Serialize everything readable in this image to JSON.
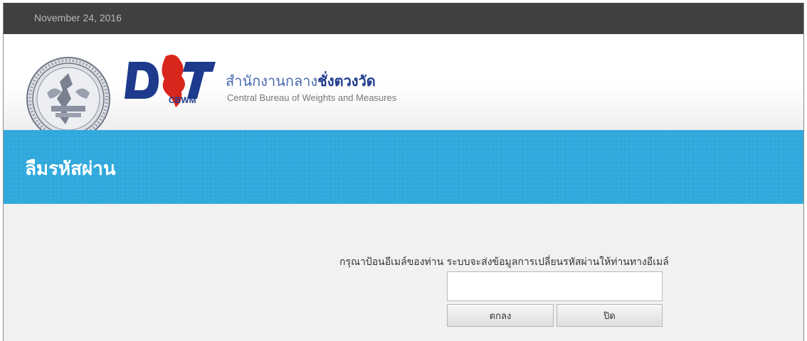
{
  "topbar": {
    "date": "November 24, 2016"
  },
  "header": {
    "logo_text": "DIT",
    "logo_subtext": "CBWM",
    "org_name_thai_prefix": "สำนักงานกลาง",
    "org_name_thai_emphasis": "ชั่งตวงวัด",
    "org_name_english": "Central Bureau of Weights and Measures"
  },
  "banner": {
    "title": "ลืมรหัสผ่าน"
  },
  "form": {
    "instruction": "กรุณาป้อนอีเมล์ของท่าน ระบบจะส่งข้อมูลการเปลี่ยนรหัสผ่านให้ท่านทางอีเมล์",
    "email_value": "",
    "email_placeholder": "",
    "ok_label": "ตกลง",
    "close_label": "ปิด"
  },
  "colors": {
    "topbar": "#404040",
    "banner": "#2fa8dc",
    "brand_blue": "#1d3a8c",
    "brand_red": "#d9261c"
  }
}
